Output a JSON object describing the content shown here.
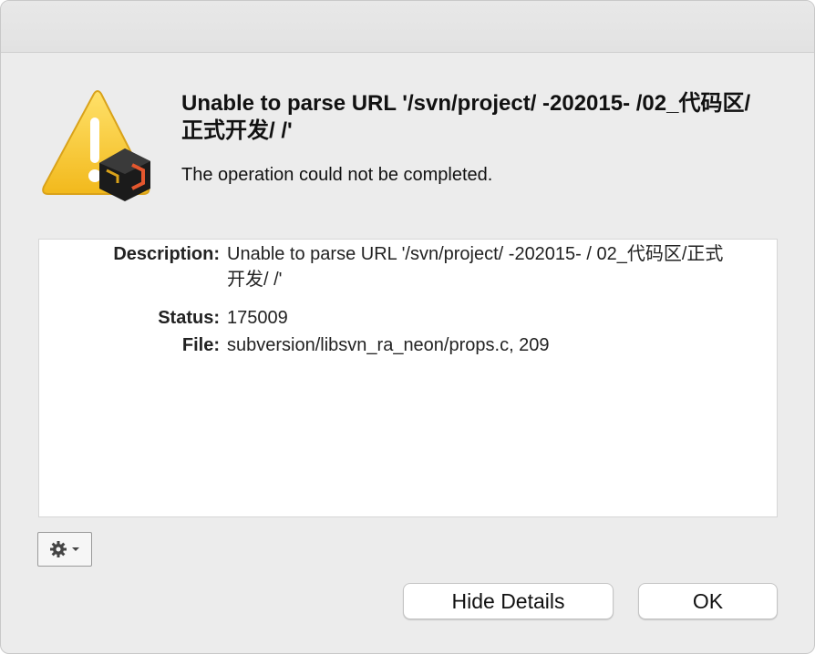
{
  "dialog": {
    "headline": "Unable to parse URL '/svn/project/ -202015- /02_代码区/正式开发/ /'",
    "subline": "The operation could not be completed."
  },
  "details": {
    "description_label": "Description:",
    "description_value": "Unable to parse URL '/svn/project/ -202015- / 02_代码区/正式开发/ /'",
    "status_label": "Status:",
    "status_value": "175009",
    "file_label": "File:",
    "file_value": "subversion/libsvn_ra_neon/props.c, 209"
  },
  "buttons": {
    "hide_details": "Hide Details",
    "ok": "OK"
  },
  "icons": {
    "warning": "warning-triangle-icon",
    "gear": "gear-icon",
    "chevron": "chevron-down-icon"
  },
  "colors": {
    "warning_yellow": "#f7c93a",
    "redaction": "#e8392b"
  }
}
